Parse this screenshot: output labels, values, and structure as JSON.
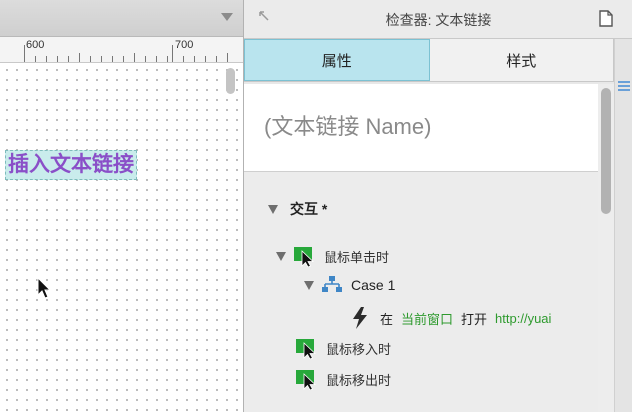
{
  "canvas": {
    "ruler": {
      "labels": [
        "600",
        "700"
      ]
    },
    "link_text": "插入文本链接"
  },
  "inspector": {
    "title": "检查器: 文本链接",
    "tabs": [
      {
        "label": "属性",
        "active": true
      },
      {
        "label": "样式",
        "active": false
      }
    ],
    "name_placeholder": "(文本链接 Name)",
    "section_label": "交互 *",
    "events": [
      {
        "label": "鼠标单击时"
      },
      {
        "label": "鼠标移入时"
      },
      {
        "label": "鼠标移出时"
      }
    ],
    "case": {
      "label": "Case 1"
    },
    "action": {
      "prefix": "在",
      "target": "当前窗口",
      "verb": "打开",
      "url": "http://yuai"
    }
  },
  "colors": {
    "active_tab": "#b9e4ee",
    "link_text": "#8a4fc8",
    "link_highlight": "#c9ecec",
    "event_icon": "#27a83a",
    "action_green": "#2e9a2e",
    "case_icon": "#3f86c6"
  },
  "icons": [
    "collapse-arrow-icon",
    "document-icon",
    "panel-menu-icon",
    "mouse-event-icon",
    "case-tree-icon",
    "lightning-icon",
    "cursor-icon",
    "disclosure-triangle-icon"
  ]
}
